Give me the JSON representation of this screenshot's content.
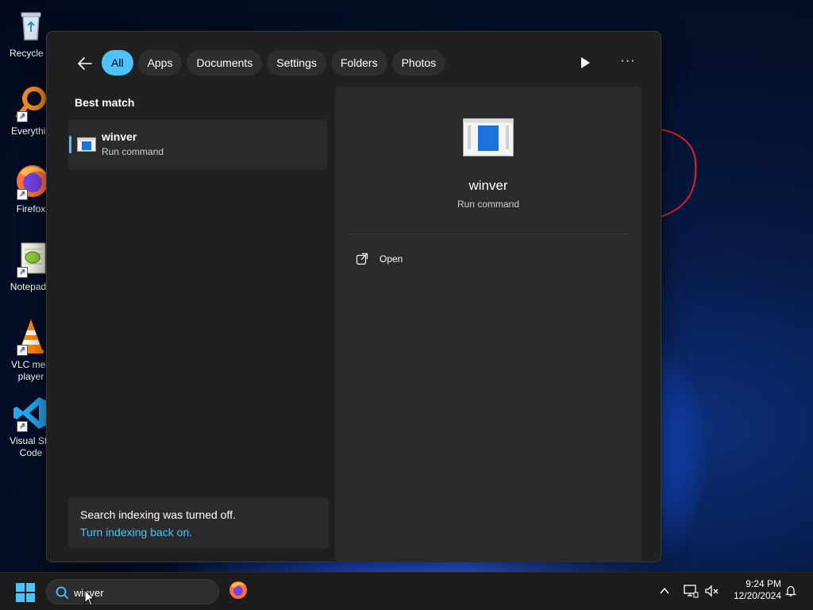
{
  "desktop": {
    "icons": [
      {
        "label": "Recycle B",
        "icon": "recycle-bin-icon"
      },
      {
        "label": "Everythin",
        "icon": "everything-search-icon"
      },
      {
        "label": "Firefox",
        "icon": "firefox-icon"
      },
      {
        "label": "Notepad+",
        "icon": "notepadpp-icon"
      },
      {
        "label": "VLC med player",
        "icon": "vlc-icon"
      },
      {
        "label": "Visual Stu Code",
        "icon": "vscode-icon"
      }
    ]
  },
  "search_panel": {
    "filters": [
      "All",
      "Apps",
      "Documents",
      "Settings",
      "Folders",
      "Photos"
    ],
    "active_filter": "All",
    "more_label": "···",
    "best_match_label": "Best match",
    "best_match": {
      "title": "winver",
      "subtitle": "Run command"
    },
    "index_notice": {
      "message": "Search indexing was turned off.",
      "link": "Turn indexing back on."
    },
    "detail": {
      "title": "winver",
      "subtitle": "Run command",
      "action_open": "Open"
    }
  },
  "taskbar": {
    "search_value": "winver",
    "time": "9:24 PM",
    "date": "12/20/2024"
  },
  "colors": {
    "accent": "#4cc2ff",
    "panel_bg": "#202020",
    "card_bg": "#2b2b2b",
    "taskbar_bg": "#1c1c1c"
  }
}
